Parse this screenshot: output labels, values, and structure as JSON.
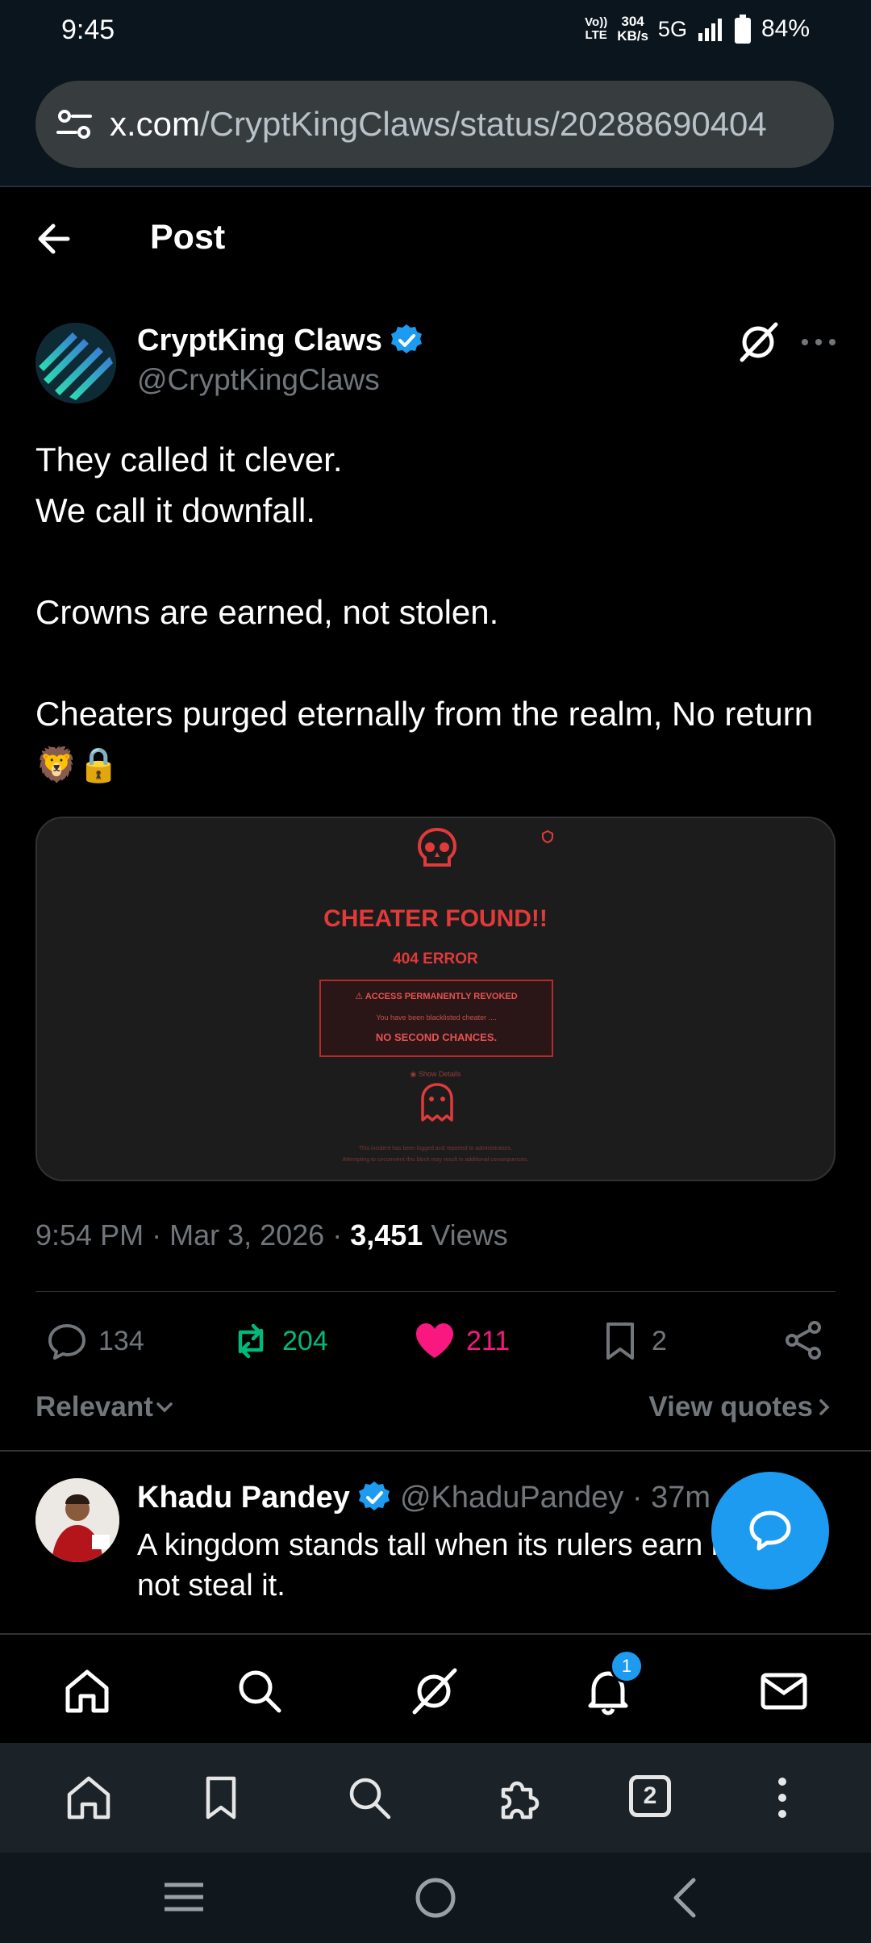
{
  "status_bar": {
    "time": "9:45",
    "volte_top": "Vo))",
    "volte_bottom": "LTE",
    "speed_value": "304",
    "speed_unit": "KB/s",
    "network": "5G",
    "battery": "84%"
  },
  "browser": {
    "url_host": "x.com",
    "url_path": "/CryptKingClaws/status/20288690404",
    "tabs_count": "2"
  },
  "header": {
    "title": "Post"
  },
  "post": {
    "author_name": "CryptKing Claws",
    "author_handle": "@CryptKingClaws",
    "text": "They called it clever.\nWe call it downfall.\n\nCrowns are earned, not stolen.\n\nCheaters purged eternally from the realm, No return 🦁🔒",
    "media": {
      "title": "CHEATER FOUND!!",
      "error": "404 ERROR",
      "box_heading": "ACCESS PERMANENTLY REVOKED",
      "box_line": "You have been blacklisted cheater ....",
      "box_footer": "NO SECOND CHANCES.",
      "details_link": "Show Details",
      "footer_line1": "This incident has been logged and reported to administrators.",
      "footer_line2": "Attempting to circumvent this block may result in additional consequences."
    },
    "time": "9:54 PM",
    "date": "Mar 3, 2026",
    "views_count": "3,451",
    "views_label": "Views",
    "replies": "134",
    "reposts": "204",
    "likes": "211",
    "bookmarks": "2"
  },
  "sort": {
    "label": "Relevant",
    "view_quotes": "View quotes"
  },
  "reply": {
    "name": "Khadu Pandey",
    "handle": "@KhaduPandey",
    "age": "· 37m",
    "text": "A kingdom stands tall when its rulers earn respect not steal it."
  },
  "app_nav": {
    "notifications_badge": "1"
  },
  "colors": {
    "background": "#000000",
    "verified": "#1d9bf0",
    "repost": "#00ba7c",
    "like": "#f91880",
    "fab": "#1d9bf0",
    "media_red": "#e03a3a"
  }
}
